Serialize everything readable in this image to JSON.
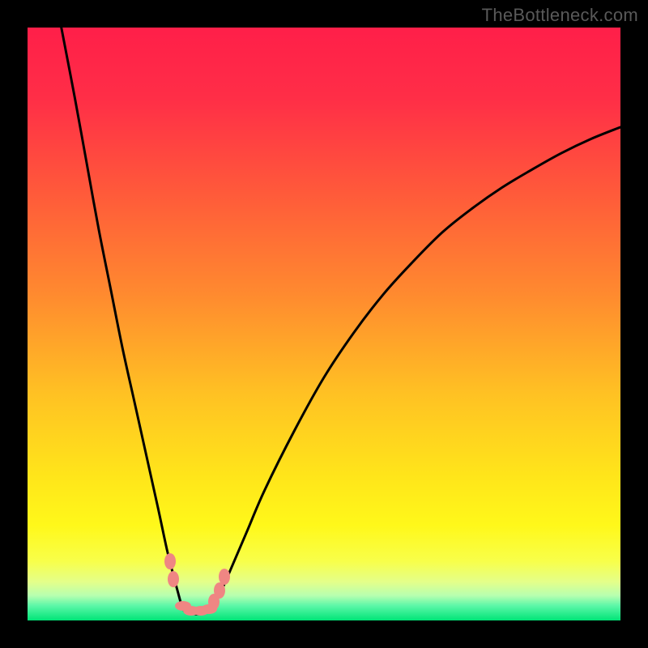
{
  "watermark": "TheBottleneck.com",
  "colors": {
    "gradient_stops": [
      {
        "offset": 0.0,
        "color": "#ff1f49"
      },
      {
        "offset": 0.12,
        "color": "#ff2e47"
      },
      {
        "offset": 0.28,
        "color": "#ff5a3a"
      },
      {
        "offset": 0.45,
        "color": "#ff8a2f"
      },
      {
        "offset": 0.62,
        "color": "#ffc223"
      },
      {
        "offset": 0.76,
        "color": "#ffe61a"
      },
      {
        "offset": 0.84,
        "color": "#fff81a"
      },
      {
        "offset": 0.9,
        "color": "#f8ff4a"
      },
      {
        "offset": 0.935,
        "color": "#e4ff8a"
      },
      {
        "offset": 0.958,
        "color": "#b7ffb0"
      },
      {
        "offset": 0.975,
        "color": "#5cf7a8"
      },
      {
        "offset": 1.0,
        "color": "#00e477"
      }
    ],
    "curve": "#000000",
    "bead": "#ef8683",
    "frame": "#000000",
    "watermark": "#595959"
  },
  "chart_data": {
    "type": "line",
    "title": "",
    "xlabel": "",
    "ylabel": "",
    "xlim": [
      0,
      100
    ],
    "ylim": [
      0,
      100
    ],
    "comment": "Bottleneck-style V curve. y=0 is optimal (bottom/green), y=100 is worst (top/red). Valley minimum near x≈26.5.",
    "series": [
      {
        "name": "left-branch",
        "x": [
          5.7,
          8,
          10,
          12,
          14,
          16,
          18,
          20,
          22,
          23.5,
          24.5,
          25.3,
          26,
          26.5
        ],
        "values": [
          100,
          88,
          77,
          66,
          56,
          46,
          37,
          28,
          19,
          12,
          8,
          5,
          2.5,
          1.5
        ]
      },
      {
        "name": "valley-floor",
        "x": [
          26.5,
          27,
          28,
          29,
          30,
          30.8
        ],
        "values": [
          1.5,
          1.2,
          1.1,
          1.1,
          1.3,
          1.6
        ]
      },
      {
        "name": "right-branch",
        "x": [
          30.8,
          32,
          34,
          37,
          40,
          45,
          50,
          55,
          60,
          65,
          70,
          75,
          80,
          85,
          90,
          95,
          100
        ],
        "values": [
          1.6,
          3.5,
          8,
          15,
          22,
          32,
          41,
          48.5,
          55,
          60.5,
          65.5,
          69.5,
          73,
          76,
          78.8,
          81.2,
          83.2
        ]
      }
    ],
    "marker_points": {
      "comment": "Salmon bead markers clustered near the valley",
      "x": [
        24.0,
        24.6,
        26.2,
        27.6,
        29.3,
        30.6,
        31.4,
        32.4,
        33.2
      ],
      "values": [
        10.0,
        7.0,
        2.4,
        1.7,
        1.6,
        1.9,
        3.1,
        5.0,
        7.4
      ]
    }
  }
}
